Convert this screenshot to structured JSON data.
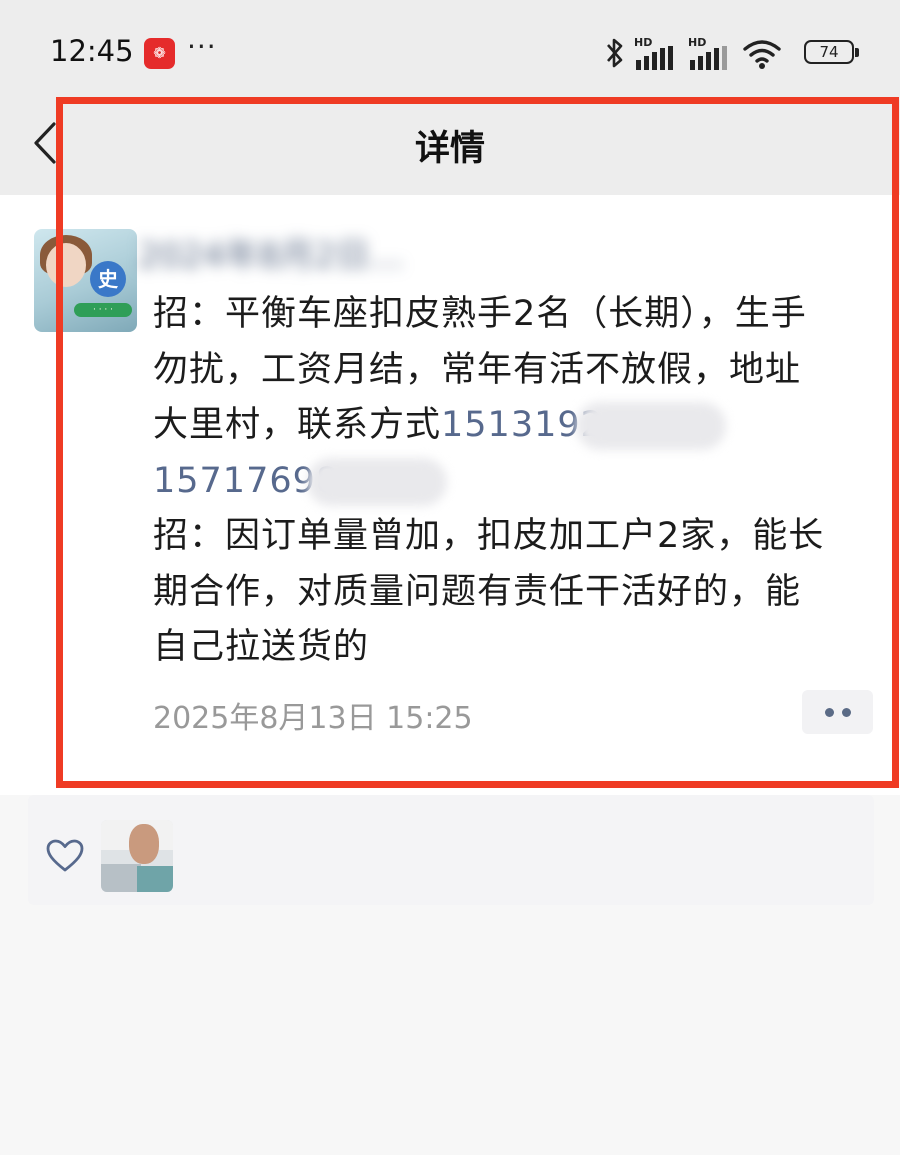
{
  "status_bar": {
    "time": "12:45",
    "app_badge_icon": "pinduoduo-app-icon",
    "more": "···",
    "network_1": "HD",
    "network_2": "HD",
    "battery": "74"
  },
  "nav": {
    "back_icon": "chevron-left-icon",
    "title": "详情"
  },
  "post": {
    "author_name_blurred": "2024年8月2日…",
    "avatar_char": "史",
    "text_lines": {
      "l1": "招：平衡车座扣皮熟手2名（长期），生手",
      "l2": "勿扰，工资月结，常年有活不放假，地址",
      "l3_text": "大里村，联系方式",
      "l3_phone": "1513192",
      "l4_phone": "15717698",
      "l5": "招：因订单量曾加，扣皮加工户2家，能长",
      "l6": "期合作，对质量问题有责任干活好的，能",
      "l7": "自己拉送货的"
    },
    "time": "2025年8月13日 15:25"
  },
  "likes": {
    "heart_icon": "heart-outline-icon"
  },
  "colors": {
    "highlight": "#ef3b24",
    "link": "#57698d",
    "header_bg": "#ededed"
  }
}
